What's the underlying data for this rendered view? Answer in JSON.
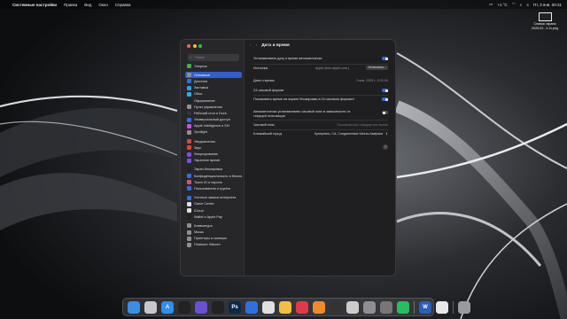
{
  "menubar": {
    "apple": "",
    "app": "Системные настройки",
    "items": [
      "Правка",
      "Вид",
      "Окно",
      "Справка"
    ],
    "temp": "+1 °C",
    "clock": "Пт, 3 янв. 00:31"
  },
  "screenshot": {
    "caption1": "Снимок экрана",
    "caption2": "2025-02...4.11.png"
  },
  "sidebar": {
    "search_placeholder": "Поиск",
    "items": [
      {
        "label": "Энергия",
        "color": "#37b24d"
      },
      {
        "label": "Основные",
        "color": "#8e8e93"
      },
      {
        "label": "Дисплеи",
        "color": "#2f6fe0"
      },
      {
        "label": "Заставка",
        "color": "#2f9fe0"
      },
      {
        "label": "Обои",
        "color": "#2fb0e0"
      },
      {
        "label": "Оформление",
        "color": "#222222"
      },
      {
        "label": "Пункт управления",
        "color": "#8e8e93"
      },
      {
        "label": "Рабочий стол и Dock",
        "color": "#333333"
      },
      {
        "label": "Универсальный доступ",
        "color": "#2f6fe0"
      },
      {
        "label": "Apple Intelligence и Siri",
        "color": "#d04fe0"
      },
      {
        "label": "Spotlight",
        "color": "#8e8e93"
      },
      {
        "label": "Уведомления",
        "color": "#e0443a"
      },
      {
        "label": "Звук",
        "color": "#e0443a"
      },
      {
        "label": "Фокусирование",
        "color": "#7a4fe0"
      },
      {
        "label": "Экранное время",
        "color": "#7a4fe0"
      },
      {
        "label": "Экран блокировки",
        "color": "#222222"
      },
      {
        "label": "Конфиденциальность и безопасность",
        "color": "#2f6fe0"
      },
      {
        "label": "Touch ID и пароль",
        "color": "#e04f6f"
      },
      {
        "label": "Пользователи и группы",
        "color": "#2f6fe0"
      },
      {
        "label": "Учетные записи интернета",
        "color": "#2f6fe0"
      },
      {
        "label": "Game Center",
        "color": "#e0e0e0"
      },
      {
        "label": "iCloud",
        "color": "#e0e0e0"
      },
      {
        "label": "Wallet и Apple Pay",
        "color": "#222222"
      },
      {
        "label": "Клавиатура",
        "color": "#8e8e93"
      },
      {
        "label": "Мышь",
        "color": "#8e8e93"
      },
      {
        "label": "Принтеры и сканеры",
        "color": "#8e8e93"
      },
      {
        "label": "Планшет Wacom",
        "color": "#8e8e93"
      }
    ],
    "selected_index": 1
  },
  "main": {
    "title": "Дата и время",
    "auto_date_label": "Устанавливать дату и время автоматически",
    "source_label": "Источник",
    "source_value": "Apple (time.apple.com.)",
    "set_button": "Установить...",
    "datetime_label": "Дата и время",
    "datetime_value": "3 янв. 2025 г., 0:31:34",
    "h24_label": "24-часовой формат",
    "lockscreen24_label": "Показывать время на экране блокировки в 24-часовом формате",
    "auto_tz_label": "Автоматически устанавливать часовой пояс в зависимости от текущей геопозиции",
    "tz_label": "Часовой пояс",
    "tz_value": "Тихоокеанское стандартное время",
    "city_label": "Ближайший город",
    "city_value": "Купертино, CA, Соединенные Штаты Америки",
    "help": "?"
  },
  "dock": {
    "apps": [
      {
        "name": "Finder",
        "color": "#3a8ee6",
        "glyph": ""
      },
      {
        "name": "Launchpad",
        "color": "#c8c8cc",
        "glyph": ""
      },
      {
        "name": "App Store",
        "color": "#2f8ef0",
        "glyph": "A"
      },
      {
        "name": "Final Cut",
        "color": "#222",
        "glyph": ""
      },
      {
        "name": "iTunes",
        "color": "#6a4fd0",
        "glyph": ""
      },
      {
        "name": "Podcast",
        "color": "#222",
        "glyph": ""
      },
      {
        "name": "Photoshop",
        "color": "#0b2a4a",
        "glyph": "Ps"
      },
      {
        "name": "Pencil",
        "color": "#2f6fe0",
        "glyph": ""
      },
      {
        "name": "Mail",
        "color": "#e0e0e0",
        "glyph": ""
      },
      {
        "name": "Photos",
        "color": "#f0c040",
        "glyph": ""
      },
      {
        "name": "Music",
        "color": "#e03a4a",
        "glyph": ""
      },
      {
        "name": "Books",
        "color": "#f08a2a",
        "glyph": ""
      },
      {
        "name": "Clock",
        "color": "#333",
        "glyph": ""
      },
      {
        "name": "Dictionary",
        "color": "#ccc",
        "glyph": ""
      },
      {
        "name": "Settings",
        "color": "#8e8e93",
        "glyph": ""
      },
      {
        "name": "Automator",
        "color": "#777",
        "glyph": ""
      },
      {
        "name": "WhatsApp",
        "color": "#25c05a",
        "glyph": ""
      },
      {
        "name": "Word",
        "color": "#2b5fb8",
        "glyph": "W"
      },
      {
        "name": "Document",
        "color": "#e8e8e8",
        "glyph": ""
      },
      {
        "name": "Trash",
        "color": "#9a9aa0",
        "glyph": ""
      }
    ]
  }
}
